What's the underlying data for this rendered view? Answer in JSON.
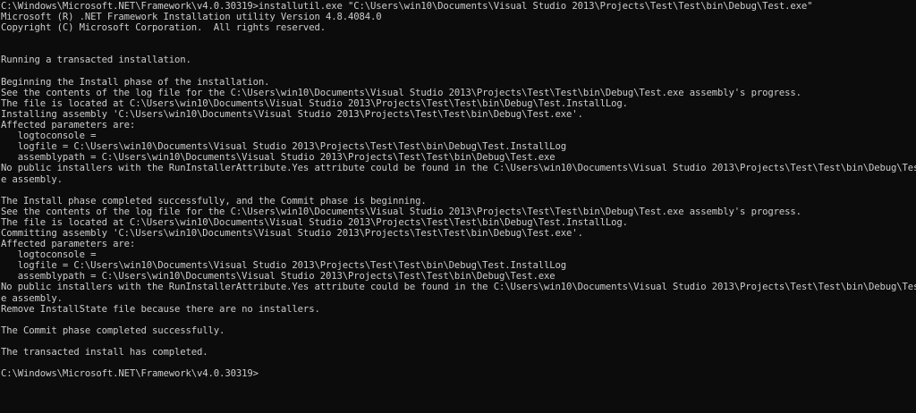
{
  "console": {
    "lines": [
      "C:\\Windows\\Microsoft.NET\\Framework\\v4.0.30319>installutil.exe \"C:\\Users\\win10\\Documents\\Visual Studio 2013\\Projects\\Test\\Test\\bin\\Debug\\Test.exe\"",
      "Microsoft (R) .NET Framework Installation utility Version 4.8.4084.0",
      "Copyright (C) Microsoft Corporation.  All rights reserved.",
      "",
      "",
      "Running a transacted installation.",
      "",
      "Beginning the Install phase of the installation.",
      "See the contents of the log file for the C:\\Users\\win10\\Documents\\Visual Studio 2013\\Projects\\Test\\Test\\bin\\Debug\\Test.exe assembly's progress.",
      "The file is located at C:\\Users\\win10\\Documents\\Visual Studio 2013\\Projects\\Test\\Test\\bin\\Debug\\Test.InstallLog.",
      "Installing assembly 'C:\\Users\\win10\\Documents\\Visual Studio 2013\\Projects\\Test\\Test\\bin\\Debug\\Test.exe'.",
      "Affected parameters are:",
      "   logtoconsole =",
      "   logfile = C:\\Users\\win10\\Documents\\Visual Studio 2013\\Projects\\Test\\Test\\bin\\Debug\\Test.InstallLog",
      "   assemblypath = C:\\Users\\win10\\Documents\\Visual Studio 2013\\Projects\\Test\\Test\\bin\\Debug\\Test.exe",
      "No public installers with the RunInstallerAttribute.Yes attribute could be found in the C:\\Users\\win10\\Documents\\Visual Studio 2013\\Projects\\Test\\Test\\bin\\Debug\\Test.ex",
      "e assembly.",
      "",
      "The Install phase completed successfully, and the Commit phase is beginning.",
      "See the contents of the log file for the C:\\Users\\win10\\Documents\\Visual Studio 2013\\Projects\\Test\\Test\\bin\\Debug\\Test.exe assembly's progress.",
      "The file is located at C:\\Users\\win10\\Documents\\Visual Studio 2013\\Projects\\Test\\Test\\bin\\Debug\\Test.InstallLog.",
      "Committing assembly 'C:\\Users\\win10\\Documents\\Visual Studio 2013\\Projects\\Test\\Test\\bin\\Debug\\Test.exe'.",
      "Affected parameters are:",
      "   logtoconsole =",
      "   logfile = C:\\Users\\win10\\Documents\\Visual Studio 2013\\Projects\\Test\\Test\\bin\\Debug\\Test.InstallLog",
      "   assemblypath = C:\\Users\\win10\\Documents\\Visual Studio 2013\\Projects\\Test\\Test\\bin\\Debug\\Test.exe",
      "No public installers with the RunInstallerAttribute.Yes attribute could be found in the C:\\Users\\win10\\Documents\\Visual Studio 2013\\Projects\\Test\\Test\\bin\\Debug\\Test.ex",
      "e assembly.",
      "Remove InstallState file because there are no installers.",
      "",
      "The Commit phase completed successfully.",
      "",
      "The transacted install has completed.",
      ""
    ],
    "prompt": "C:\\Windows\\Microsoft.NET\\Framework\\v4.0.30319>"
  },
  "colors": {
    "background": "#0c0c0c",
    "foreground": "#cccccc"
  }
}
